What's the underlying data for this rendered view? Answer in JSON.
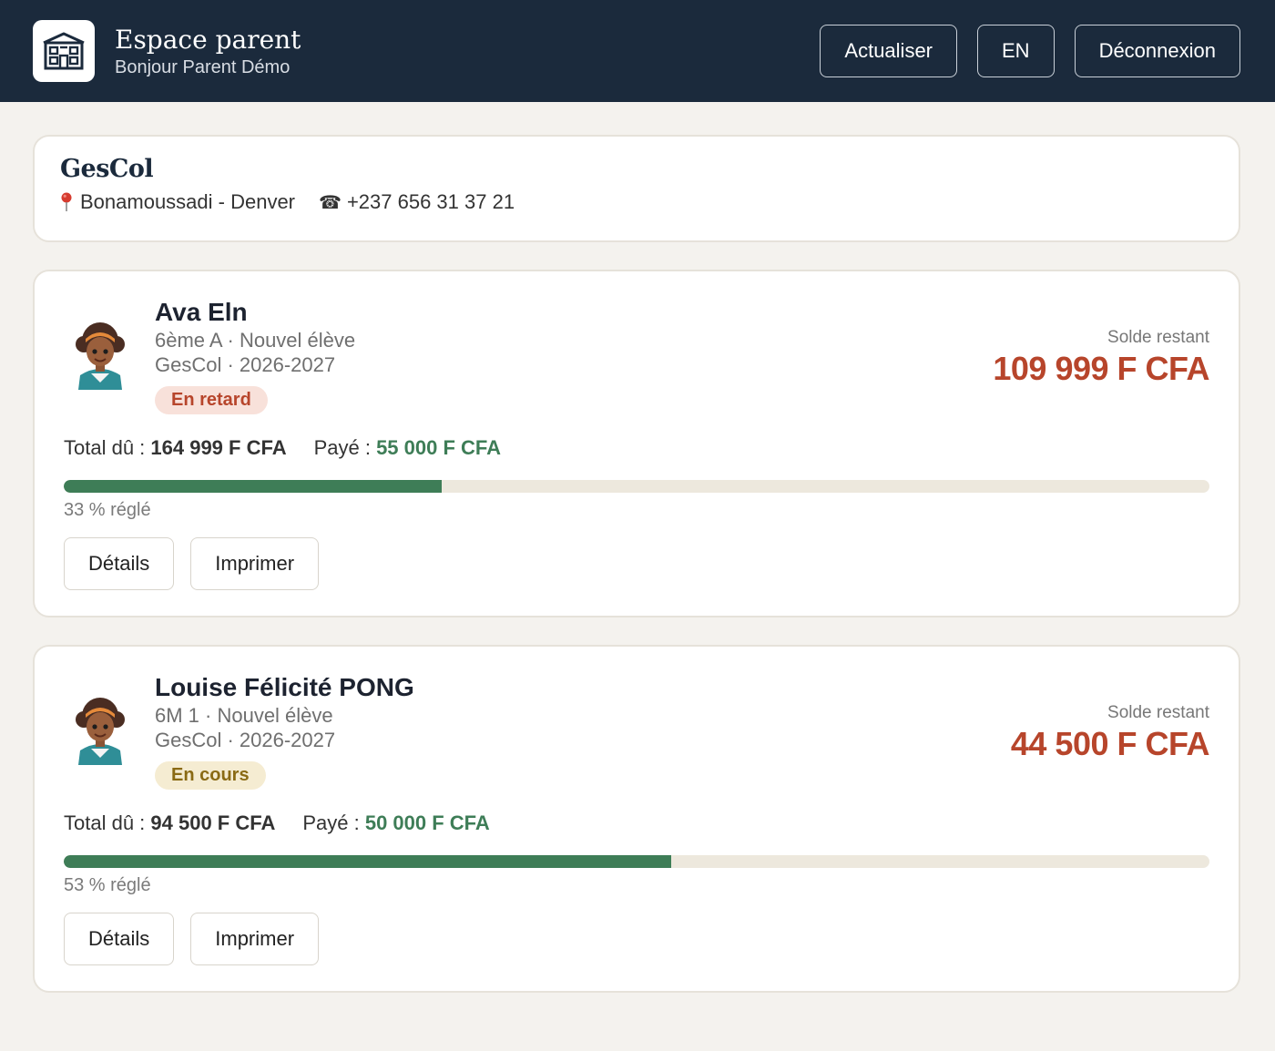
{
  "header": {
    "title": "Espace parent",
    "subtitle": "Bonjour Parent Démo",
    "refresh_label": "Actualiser",
    "lang_label": "EN",
    "logout_label": "Déconnexion"
  },
  "school": {
    "name": "GesCol",
    "address": "Bonamoussadi - Denver",
    "phone": "+237 656 31 37 21"
  },
  "students": [
    {
      "name": "Ava Eln",
      "class_line": "6ème A · Nouvel élève",
      "year_line": "GesCol · 2026-2027",
      "status": "En retard",
      "balance_label": "Solde restant",
      "balance_value": "109 999 F CFA",
      "total_label": "Total dû : ",
      "total_value": "164 999 F CFA",
      "paid_label": "Payé : ",
      "paid_value": "55 000 F CFA",
      "progress_percent": 33,
      "progress_text": "33 % réglé",
      "details_label": "Détails",
      "print_label": "Imprimer"
    },
    {
      "name": "Louise Félicité PONG",
      "class_line": "6M 1 · Nouvel élève",
      "year_line": "GesCol · 2026-2027",
      "status": "En cours",
      "balance_label": "Solde restant",
      "balance_value": "44 500 F CFA",
      "total_label": "Total dû : ",
      "total_value": "94 500 F CFA",
      "paid_label": "Payé : ",
      "paid_value": "50 000 F CFA",
      "progress_percent": 53,
      "progress_text": "53 % réglé",
      "details_label": "Détails",
      "print_label": "Imprimer"
    }
  ],
  "colors": {
    "header_bg": "#1b2a3c",
    "balance": "#b7452b",
    "paid": "#3e7d57",
    "late_badge_bg": "#f8e1da",
    "ongoing_badge_bg": "#f5ecd2"
  },
  "icons": {
    "logo": "school-building-icon",
    "address": "map-pin-icon",
    "phone": "telephone-icon",
    "avatar": "student-avatar"
  }
}
